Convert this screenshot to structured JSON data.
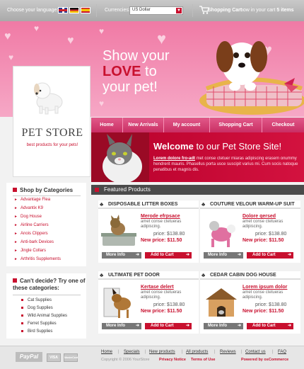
{
  "topbar": {
    "language_label": "Choose your language:",
    "currencies_label": "Currencies:",
    "currency_value": "US Dollar",
    "cart_title": "Shopping Cart",
    "cart_text": "now in your cart",
    "cart_count": "5 items"
  },
  "banner": {
    "line1": "Show your",
    "love": "LOVE",
    "to": "to",
    "line3": "your pet!"
  },
  "logo": {
    "title": "PET STORE",
    "subtitle": "best products for your pets!"
  },
  "nav": {
    "items": [
      "Home",
      "New Arrivals",
      "My account",
      "Shopping Cart",
      "Checkout"
    ]
  },
  "welcome": {
    "heading_pre": "Welcome",
    "heading_post": "to our Pet Store Site!",
    "lead": "Lorem dolore fro-adt",
    "body": "met conse ctetuer miaras adipiscing erasem onummy hendrerit mauris. Phasellus porta usce suscipit varius mi. Cum socis natoque penatibus et magnis dis."
  },
  "featured": {
    "title": "Featured Products"
  },
  "categories": {
    "title": "Shop by Categories",
    "items": [
      "Advantage Flea",
      "Advantix K9",
      "Dog House",
      "Airline Carriers",
      "Anois Clippers",
      "Anti-bark Devices",
      "Jingle Collars",
      "Arthritis Supplements"
    ]
  },
  "supplies": {
    "title": "Can't decide? Try one of these categories:",
    "items": [
      "Cat Supplies",
      "Dog Supplies",
      "Wild Animal Supplies",
      "Ferret Supplies",
      "Bird Supplies"
    ]
  },
  "products": [
    {
      "title": "DISPOSABLE LITTER BOXES",
      "name": "Merode efrpsace",
      "desc": "amet conse ctetueras adipiscing.",
      "price": "price: $138.80",
      "new_price": "New price: $11.50",
      "more": "More Info",
      "cart": "Add to Cart"
    },
    {
      "title": "COUTURE VELOUR WARM-UP SUIT",
      "name": "Dolore qersed",
      "desc": "amet conse ctetueras adipiscing.",
      "price": "price: $138.80",
      "new_price": "New price: $11.50",
      "more": "More Info",
      "cart": "Add to Cart"
    },
    {
      "title": "ULTIMATE PET DOOR",
      "name": "Kertase delert",
      "desc": "amet conse ctetueras adipiscing.",
      "price": "price: $138.80",
      "new_price": "New price: $11.50",
      "more": "More Info",
      "cart": "Add to Cart"
    },
    {
      "title": "CEDAR CABIN DOG HOUSE",
      "name": "Lorem ipsum dolor",
      "desc": "amet conse ctetueras adipiscing.",
      "price": "price: $138.80",
      "new_price": "New price: $11.50",
      "more": "More Info",
      "cart": "Add to Cart"
    }
  ],
  "footer": {
    "paypal": "PayPal",
    "visa": "VISA",
    "mc": "MasterCard",
    "links": [
      "Home",
      "Specials",
      "New products",
      "All products",
      "Reviews",
      "Contact us",
      "FAQ"
    ],
    "copyright": "Copyright © 2006 YourStore",
    "privacy": "Privacy Notice",
    "terms": "Terms of Use",
    "powered": "Powered by osCommerce"
  },
  "colors": {
    "accent": "#c8102e",
    "pink": "#f07aa5"
  }
}
